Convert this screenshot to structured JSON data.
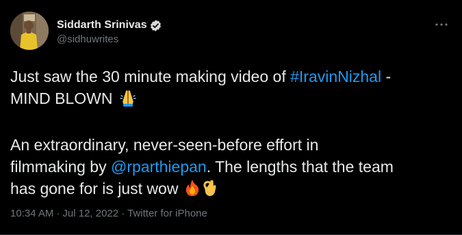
{
  "author": {
    "display_name": "Siddarth Srinivas",
    "handle": "@sidhuwrites",
    "verified": true
  },
  "tweet": {
    "line1_prefix": "Just saw the 30 minute making video of ",
    "hashtag": "#IravinNizhal",
    "line1_suffix": " -",
    "line2_text": "MIND BLOWN ",
    "line2_emoji": "folded-hands",
    "line3": "An extraordinary, never-seen-before effort in",
    "line4_prefix": "filmmaking by ",
    "mention": "@rparthiepan",
    "line4_suffix": ". The lengths that the team",
    "line5_text": "has gone for is just wow ",
    "line5_emojis": [
      "fire",
      "ok-hand"
    ]
  },
  "meta": {
    "time": "10:34 AM",
    "separator": "·",
    "date": "Jul 12, 2022",
    "source": "Twitter for iPhone"
  },
  "colors": {
    "background": "#000000",
    "text": "#e7e9ea",
    "secondary": "#71767b",
    "link": "#1d9bf0"
  }
}
